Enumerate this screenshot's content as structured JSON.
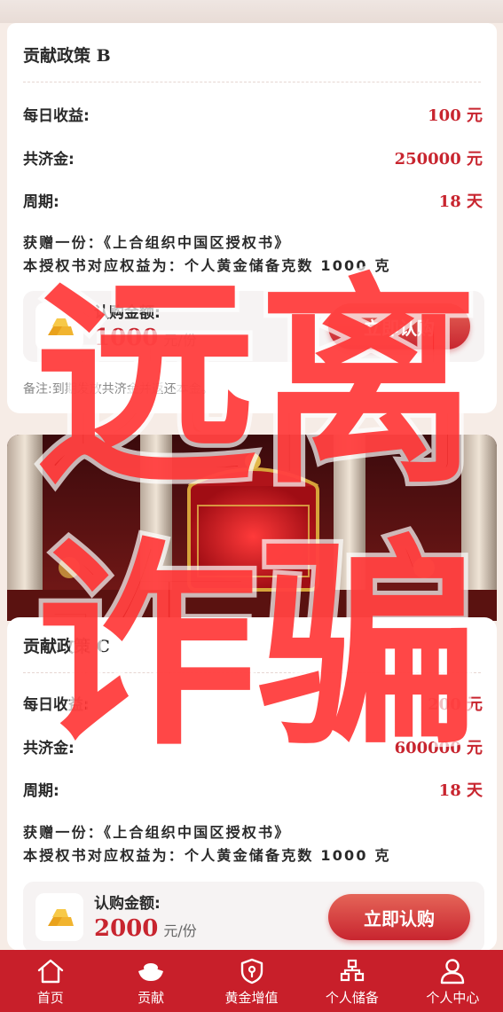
{
  "card_b": {
    "title": "贡献政策 B",
    "daily_label": "每日收益:",
    "daily_value": "100 元",
    "fund_label": "共济金:",
    "fund_value": "250000 元",
    "period_label": "周期:",
    "period_value": "18 天",
    "gift_line1": "获赠一份：《上合组织中国区授权书》",
    "gift_line2": "本授权书对应权益为：个人黄金储备克数 1000 克",
    "buy_label": "认购金额:",
    "buy_amount": "1000",
    "buy_unit": "元/份",
    "buy_button": "立即认购",
    "note": "备注:到期发放共济金并返还本金。"
  },
  "card_c": {
    "title": "贡献政策 C",
    "daily_label": "每日收益:",
    "daily_value": "200 元",
    "fund_label": "共济金:",
    "fund_value": "600000 元",
    "period_label": "周期:",
    "period_value": "18 天",
    "gift_line1": "获赠一份：《上合组织中国区授权书》",
    "gift_line2": "本授权书对应权益为：个人黄金储备克数 1000 克",
    "buy_label": "认购金额:",
    "buy_amount": "2000",
    "buy_unit": "元/份",
    "buy_button": "立即认购"
  },
  "bottom_nav": [
    {
      "label": "首页",
      "icon": "home-icon"
    },
    {
      "label": "贡献",
      "icon": "gold-ingot-icon"
    },
    {
      "label": "黄金增值",
      "icon": "shield-icon"
    },
    {
      "label": "个人储备",
      "icon": "hierarchy-icon"
    },
    {
      "label": "个人中心",
      "icon": "user-icon"
    }
  ],
  "watermark": {
    "line1": "远离",
    "line2": "诈骗",
    "color": "#ff2d2d"
  },
  "colors": {
    "accent": "#c8252f",
    "nav_bg": "#c81f2a"
  }
}
